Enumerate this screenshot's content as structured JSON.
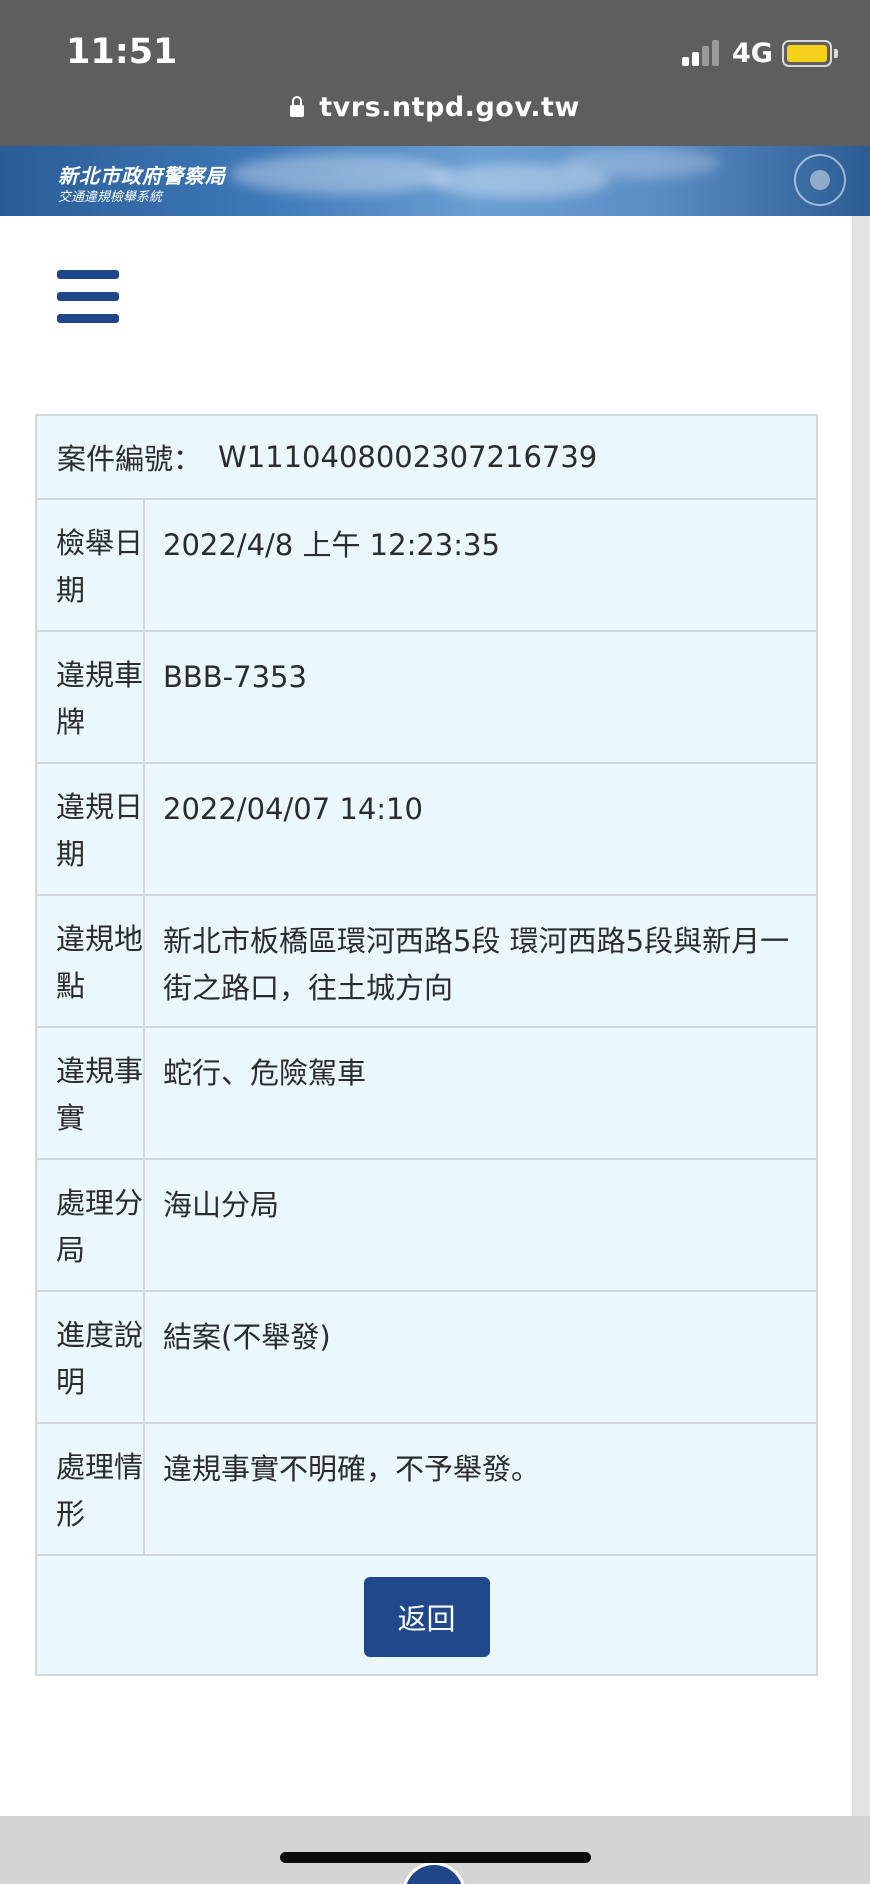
{
  "status_bar": {
    "time": "11:51",
    "network": "4G",
    "icons": [
      "signal-icon",
      "battery-icon"
    ]
  },
  "browser": {
    "url": "tvrs.ntpd.gov.tw",
    "icon": "lock-icon"
  },
  "banner": {
    "title": "新北市政府警察局",
    "subtitle": "交通違規檢舉系統"
  },
  "menu": {
    "icon": "hamburger-menu-icon"
  },
  "record": {
    "case_label": "案件編號：",
    "case_number": "W1110408002307216739",
    "rows": [
      {
        "label": "檢舉日期",
        "value": "2022/4/8 上午 12:23:35"
      },
      {
        "label": "違規車牌",
        "value": "BBB-7353"
      },
      {
        "label": "違規日期",
        "value": "2022/04/07 14:10"
      },
      {
        "label": "違規地點",
        "value": "新北市板橋區環河西路5段 環河西路5段與新月一街之路口，往土城方向"
      },
      {
        "label": "違規事實",
        "value": "蛇行、危險駕車"
      },
      {
        "label": "處理分局",
        "value": "海山分局"
      },
      {
        "label": "進度說明",
        "value": "結案(不舉發)"
      },
      {
        "label": "處理情形",
        "value": "違規事實不明確，不予舉發。"
      }
    ],
    "back_label": "返回"
  },
  "colors": {
    "status_bar_bg": "#5e5e5e",
    "accent_blue": "#20498c",
    "table_bg": "#eaf7fd",
    "table_border": "#d2d7dc",
    "battery": "#f7d21a"
  }
}
